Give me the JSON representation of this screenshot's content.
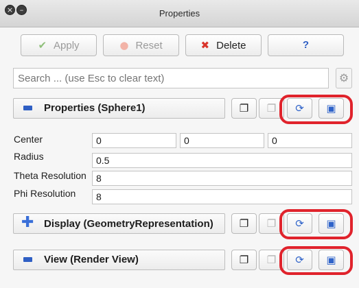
{
  "window": {
    "title": "Properties"
  },
  "toolbar": {
    "apply_label": "Apply",
    "reset_label": "Reset",
    "delete_label": "Delete",
    "help_label": "?"
  },
  "search": {
    "placeholder": "Search ... (use Esc to clear text)",
    "value": ""
  },
  "sections": {
    "properties": {
      "label": "Properties (Sphere1)",
      "expanded": true
    },
    "display": {
      "label": "Display (GeometryRepresentation)",
      "expanded": false
    },
    "view": {
      "label": "View (Render View)",
      "expanded": true
    }
  },
  "properties": {
    "center": {
      "label": "Center",
      "values": [
        "0",
        "0",
        "0"
      ]
    },
    "radius": {
      "label": "Radius",
      "value": "0.5"
    },
    "theta_resolution": {
      "label": "Theta Resolution",
      "value": "8"
    },
    "phi_resolution": {
      "label": "Phi Resolution",
      "value": "8"
    }
  },
  "icons": {
    "close": "close-icon",
    "minimize": "minimize-icon",
    "apply": "apply-icon",
    "reset": "reset-icon",
    "delete": "delete-icon",
    "help": "help-icon",
    "gear": "gear-icon",
    "copy": "copy-icon",
    "paste": "paste-icon",
    "refresh": "refresh-icon",
    "save": "save-icon"
  },
  "colors": {
    "highlight": "#e0232c",
    "accent": "#2f5fc4",
    "delete": "#d9342b"
  }
}
